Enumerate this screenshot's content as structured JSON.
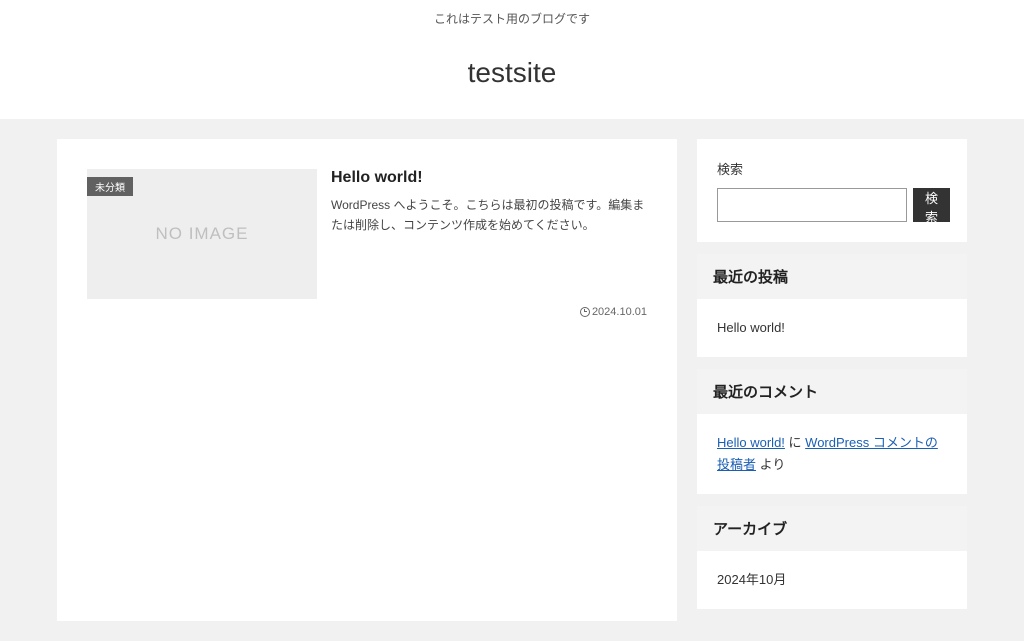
{
  "header": {
    "tagline": "これはテスト用のブログです",
    "site_title": "testsite"
  },
  "post": {
    "category": "未分類",
    "no_image_text": "NO IMAGE",
    "title": "Hello world!",
    "excerpt": "WordPress へようこそ。こちらは最初の投稿です。編集または削除し、コンテンツ作成を始めてください。",
    "date": "2024.10.01"
  },
  "sidebar": {
    "search": {
      "label": "検索",
      "button": "検索"
    },
    "recent_posts": {
      "title": "最近の投稿",
      "item": "Hello world!"
    },
    "recent_comments": {
      "title": "最近のコメント",
      "link1": "Hello world!",
      "mid": " に ",
      "link2": "WordPress コメントの投稿者",
      "tail": " より"
    },
    "archive": {
      "title": "アーカイブ",
      "item": "2024年10月"
    }
  }
}
